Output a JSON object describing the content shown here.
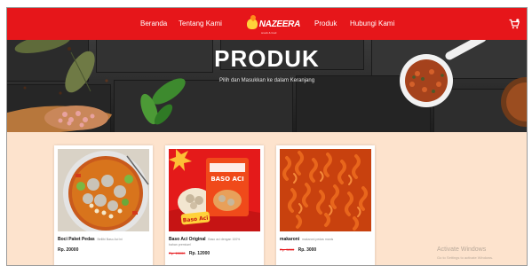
{
  "nav": {
    "links": [
      "Beranda",
      "Tentang Kami",
      "Produk",
      "Hubungi Kami"
    ],
    "brand": "NAZEERA",
    "brand_tagline": "snack & food",
    "cart_icon": "cart-icon",
    "color": "#e6161a"
  },
  "hero": {
    "title": "PRODUK",
    "subtitle": "Pilih dan Masukkan ke dalam Keranjang"
  },
  "products": [
    {
      "name": "Boci Paket Pedas",
      "desc": "Bellibi Baso Aci ini",
      "desc2": "",
      "old_price": "",
      "price": "Rp. 20000"
    },
    {
      "name": "Baso Aci Original",
      "desc": "Baso aci dengan 100%",
      "desc2": "bahan premium!",
      "old_price": "Rp. 15000",
      "price": "Rp. 12000"
    },
    {
      "name": "makaroni",
      "desc": "makaroni pedas manis",
      "desc2": "",
      "old_price": "Rp. 5000",
      "price": "Rp. 3000"
    }
  ],
  "package_label": "BASO ACI",
  "package_sticker": "Baso Aci",
  "watermark": {
    "title": "Activate Windows",
    "sub": "Go to Settings to activate Windows."
  }
}
